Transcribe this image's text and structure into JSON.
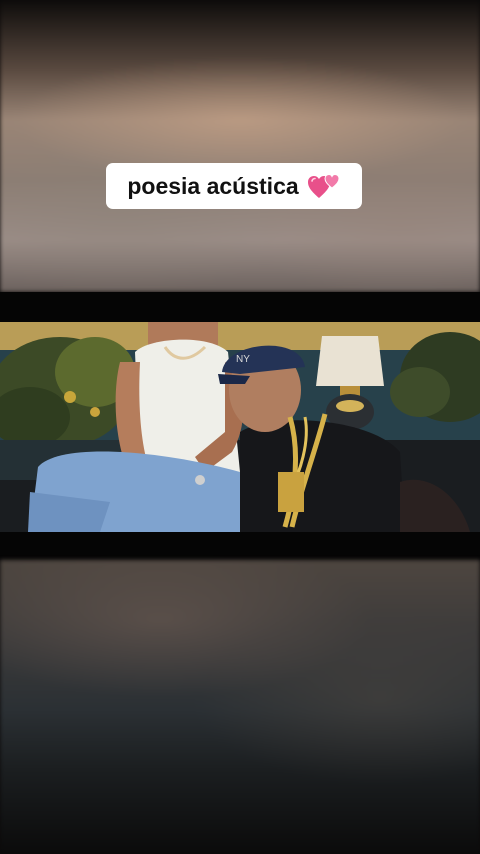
{
  "caption": {
    "text": "poesia acústica",
    "emoji_icon": "two-hearts-icon"
  },
  "video": {
    "cap_text": "NY"
  },
  "colors": {
    "caption_bg": "#ffffff",
    "caption_text": "#111111",
    "heart_pink": "#e8508a"
  }
}
